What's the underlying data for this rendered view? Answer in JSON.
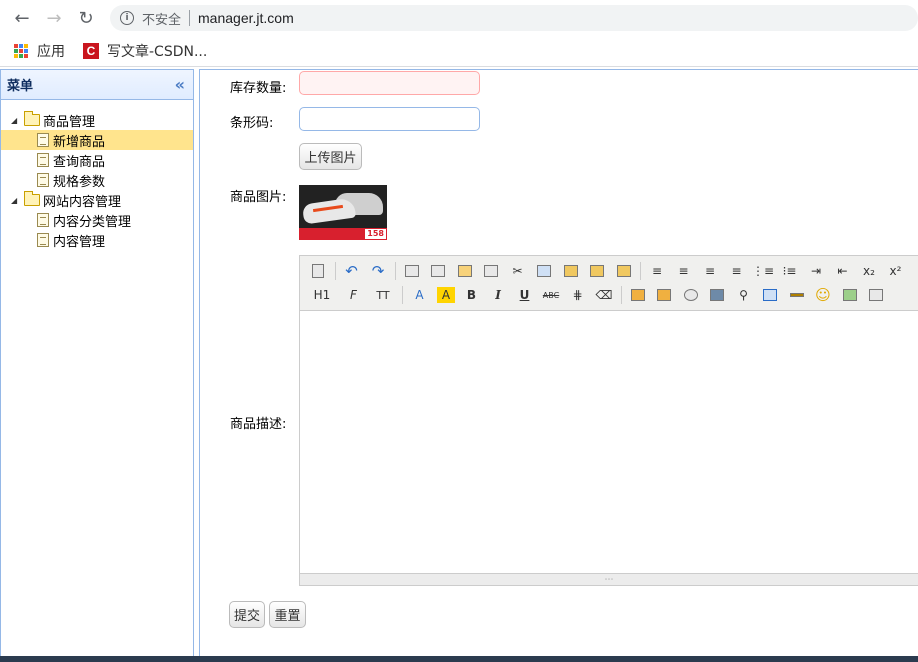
{
  "browser": {
    "security_label": "不安全",
    "url": "manager.jt.com",
    "bookmarks": [
      {
        "label": "应用"
      },
      {
        "label": "写文章-CSDN..."
      }
    ]
  },
  "menu": {
    "title": "菜单",
    "tree": [
      {
        "label": "商品管理",
        "children": [
          "新增商品",
          "查询商品",
          "规格参数"
        ]
      },
      {
        "label": "网站内容管理",
        "children": [
          "内容分类管理",
          "内容管理"
        ]
      }
    ],
    "selected": "新增商品"
  },
  "form": {
    "stock_label": "库存数量:",
    "stock_value": "",
    "barcode_label": "条形码:",
    "barcode_value": "",
    "upload_button": "上传图片",
    "image_label": "商品图片:",
    "image_price_tag": "158",
    "desc_label": "商品描述:",
    "submit_button": "提交",
    "reset_button": "重置"
  },
  "editor": {
    "toolbar_row1": [
      "source-icon",
      "undo-icon",
      "redo-icon",
      "preview-icon",
      "print-icon",
      "template-icon",
      "code-icon",
      "cut-icon",
      "copy-icon",
      "paste-icon",
      "paste-text-icon",
      "paste-word-icon",
      "align-left-icon",
      "align-center-icon",
      "align-right-icon",
      "justify-icon",
      "ordered-list-icon",
      "unordered-list-icon",
      "indent-icon",
      "outdent-icon",
      "subscript-icon",
      "superscript-icon"
    ],
    "toolbar_row2": [
      "heading-icon",
      "font-family-icon",
      "font-size-icon",
      "font-color-icon",
      "highlight-color-icon",
      "bold-icon",
      "italic-icon",
      "underline-icon",
      "strikethrough-icon",
      "line-height-icon",
      "remove-format-icon",
      "image-icon",
      "multi-image-icon",
      "flash-icon",
      "media-icon",
      "attachment-icon",
      "table-icon",
      "horizontal-rule-icon",
      "emoticon-icon",
      "map-icon",
      "page-break-icon"
    ],
    "heading_label": "H1",
    "font_size_label": "TT",
    "sub_label": "x₂",
    "sup_label": "x²"
  }
}
